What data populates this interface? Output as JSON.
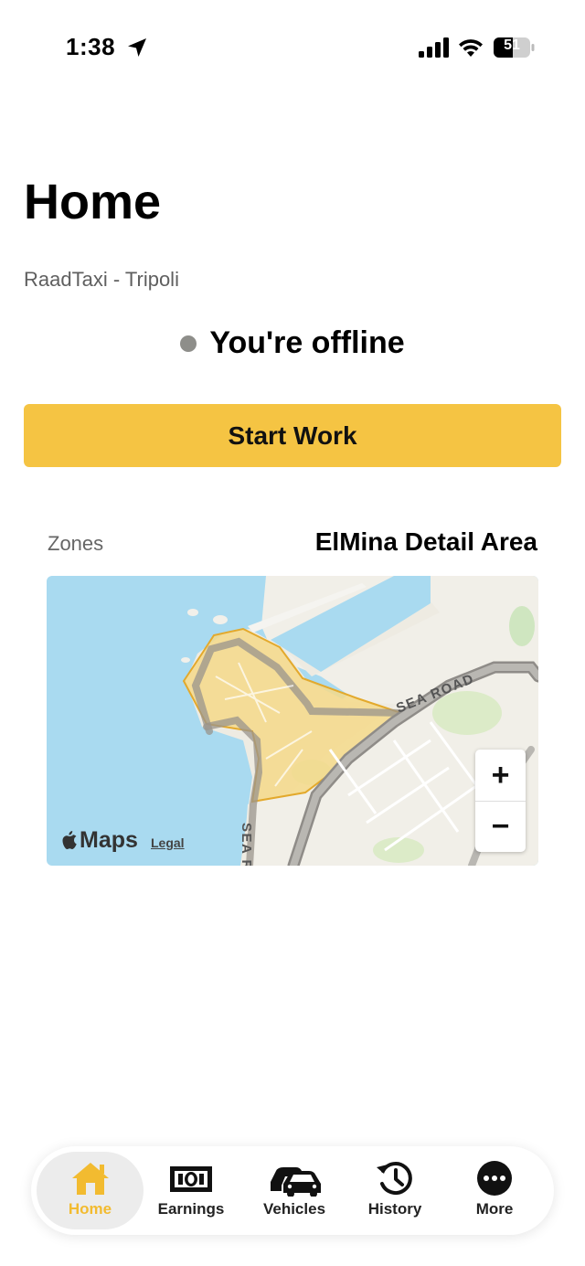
{
  "status_bar": {
    "time": "1:38",
    "battery": "51"
  },
  "header": {
    "title": "Home",
    "subtitle": "RaadTaxi - Tripoli"
  },
  "status": {
    "text": "You're offline",
    "dot_color": "#8e8e8a"
  },
  "start_button": {
    "label": "Start Work",
    "color": "#f5c443"
  },
  "zones": {
    "label": "Zones",
    "name": "ElMina Detail Area"
  },
  "map": {
    "road_label_1": "SEA ROAD",
    "road_label_2": "SEA R",
    "zoom_in": "+",
    "zoom_out": "−",
    "logo": "Maps",
    "legal": "Legal",
    "zone_fill": "#f5d98a",
    "water_color": "#a9daf0"
  },
  "tabs": [
    {
      "label": "Home",
      "icon": "home-icon",
      "active": true
    },
    {
      "label": "Earnings",
      "icon": "banknote-icon"
    },
    {
      "label": "Vehicles",
      "icon": "cars-icon"
    },
    {
      "label": "History",
      "icon": "history-icon"
    },
    {
      "label": "More",
      "icon": "more-icon"
    }
  ],
  "accent_color": "#f2bb30"
}
